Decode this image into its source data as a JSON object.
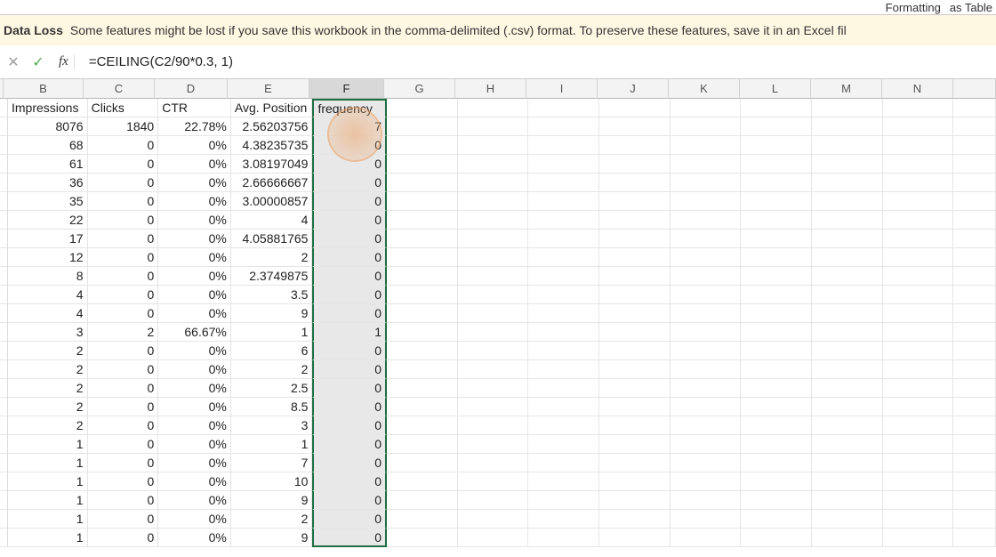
{
  "ribbon": {
    "formatting": "Formatting",
    "as_table": "as Table"
  },
  "warning": {
    "title": "Data Loss",
    "text": "Some features might be lost if you save this workbook in the comma-delimited (.csv) format. To preserve these features, save it in an Excel fil"
  },
  "formula_bar": {
    "fx": "fx",
    "value": "=CEILING(C2/90*0.3, 1)"
  },
  "columns": [
    "B",
    "C",
    "D",
    "E",
    "F",
    "G",
    "H",
    "I",
    "J",
    "K",
    "L",
    "M",
    "N"
  ],
  "selected_column": "F",
  "headers": {
    "B": "Impressions",
    "C": "Clicks",
    "D": "CTR",
    "E": "Avg. Position",
    "F": "frequency"
  },
  "rows": [
    {
      "B": "8076",
      "C": "1840",
      "D": "22.78%",
      "E": "2.56203756",
      "F": "7"
    },
    {
      "B": "68",
      "C": "0",
      "D": "0%",
      "E": "4.38235735",
      "F": "0"
    },
    {
      "B": "61",
      "C": "0",
      "D": "0%",
      "E": "3.08197049",
      "F": "0"
    },
    {
      "B": "36",
      "C": "0",
      "D": "0%",
      "E": "2.66666667",
      "F": "0"
    },
    {
      "B": "35",
      "C": "0",
      "D": "0%",
      "E": "3.00000857",
      "F": "0"
    },
    {
      "B": "22",
      "C": "0",
      "D": "0%",
      "E": "4",
      "F": "0"
    },
    {
      "B": "17",
      "C": "0",
      "D": "0%",
      "E": "4.05881765",
      "F": "0"
    },
    {
      "B": "12",
      "C": "0",
      "D": "0%",
      "E": "2",
      "F": "0"
    },
    {
      "B": "8",
      "C": "0",
      "D": "0%",
      "E": "2.3749875",
      "F": "0"
    },
    {
      "B": "4",
      "C": "0",
      "D": "0%",
      "E": "3.5",
      "F": "0"
    },
    {
      "B": "4",
      "C": "0",
      "D": "0%",
      "E": "9",
      "F": "0"
    },
    {
      "B": "3",
      "C": "2",
      "D": "66.67%",
      "E": "1",
      "F": "1"
    },
    {
      "B": "2",
      "C": "0",
      "D": "0%",
      "E": "6",
      "F": "0"
    },
    {
      "B": "2",
      "C": "0",
      "D": "0%",
      "E": "2",
      "F": "0"
    },
    {
      "B": "2",
      "C": "0",
      "D": "0%",
      "E": "2.5",
      "F": "0"
    },
    {
      "B": "2",
      "C": "0",
      "D": "0%",
      "E": "8.5",
      "F": "0"
    },
    {
      "B": "2",
      "C": "0",
      "D": "0%",
      "E": "3",
      "F": "0"
    },
    {
      "B": "1",
      "C": "0",
      "D": "0%",
      "E": "1",
      "F": "0"
    },
    {
      "B": "1",
      "C": "0",
      "D": "0%",
      "E": "7",
      "F": "0"
    },
    {
      "B": "1",
      "C": "0",
      "D": "0%",
      "E": "10",
      "F": "0"
    },
    {
      "B": "1",
      "C": "0",
      "D": "0%",
      "E": "9",
      "F": "0"
    },
    {
      "B": "1",
      "C": "0",
      "D": "0%",
      "E": "2",
      "F": "0"
    },
    {
      "B": "1",
      "C": "0",
      "D": "0%",
      "E": "9",
      "F": "0"
    }
  ]
}
